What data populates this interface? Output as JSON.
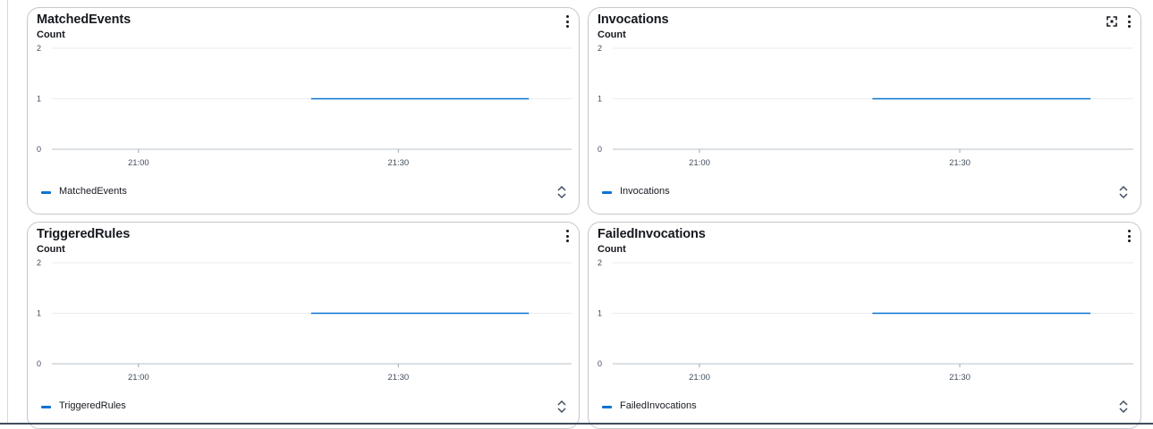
{
  "panels": [
    {
      "id": "matched-events",
      "title": "MatchedEvents",
      "unit": "Count",
      "has_expand": false,
      "legend_label": "MatchedEvents",
      "icons": [
        "more-vertical-icon",
        "sort-caret-icon"
      ]
    },
    {
      "id": "invocations",
      "title": "Invocations",
      "unit": "Count",
      "has_expand": true,
      "legend_label": "Invocations",
      "icons": [
        "expand-icon",
        "more-vertical-icon",
        "sort-caret-icon"
      ]
    },
    {
      "id": "triggered-rules",
      "title": "TriggeredRules",
      "unit": "Count",
      "has_expand": false,
      "legend_label": "TriggeredRules",
      "icons": [
        "more-vertical-icon",
        "sort-caret-icon"
      ]
    },
    {
      "id": "failed-invocations",
      "title": "FailedInvocations",
      "unit": "Count",
      "has_expand": false,
      "legend_label": "FailedInvocations",
      "icons": [
        "more-vertical-icon",
        "sort-caret-icon"
      ]
    }
  ],
  "colors": {
    "series": "#0972d3",
    "grid": "#e9ebed",
    "axis": "#d1d5db",
    "panel_border": "#c6c6cd"
  },
  "chart_data": [
    {
      "type": "line",
      "ylabel": "Count",
      "y_ticks": [
        "0",
        "1",
        "2"
      ],
      "ylim": [
        0,
        2
      ],
      "x_ticks": [
        "21:00",
        "21:30"
      ],
      "x_tick_minutes": [
        0,
        30
      ],
      "xlim_minutes": [
        -10,
        50
      ],
      "legend_position": "bottom-left",
      "series": [
        {
          "name": "MatchedEvents",
          "x_minutes": [
            20,
            45
          ],
          "values": [
            1,
            1
          ]
        }
      ]
    },
    {
      "type": "line",
      "ylabel": "Count",
      "y_ticks": [
        "0",
        "1",
        "2"
      ],
      "ylim": [
        0,
        2
      ],
      "x_ticks": [
        "21:00",
        "21:30"
      ],
      "x_tick_minutes": [
        0,
        30
      ],
      "xlim_minutes": [
        -10,
        50
      ],
      "legend_position": "bottom-left",
      "series": [
        {
          "name": "Invocations",
          "x_minutes": [
            20,
            45
          ],
          "values": [
            1,
            1
          ]
        }
      ]
    },
    {
      "type": "line",
      "ylabel": "Count",
      "y_ticks": [
        "0",
        "1",
        "2"
      ],
      "ylim": [
        0,
        2
      ],
      "x_ticks": [
        "21:00",
        "21:30"
      ],
      "x_tick_minutes": [
        0,
        30
      ],
      "xlim_minutes": [
        -10,
        50
      ],
      "legend_position": "bottom-left",
      "series": [
        {
          "name": "TriggeredRules",
          "x_minutes": [
            20,
            45
          ],
          "values": [
            1,
            1
          ]
        }
      ]
    },
    {
      "type": "line",
      "ylabel": "Count",
      "y_ticks": [
        "0",
        "1",
        "2"
      ],
      "ylim": [
        0,
        2
      ],
      "x_ticks": [
        "21:00",
        "21:30"
      ],
      "x_tick_minutes": [
        0,
        30
      ],
      "xlim_minutes": [
        -10,
        50
      ],
      "legend_position": "bottom-left",
      "series": [
        {
          "name": "FailedInvocations",
          "x_minutes": [
            20,
            45
          ],
          "values": [
            1,
            1
          ]
        }
      ]
    }
  ]
}
